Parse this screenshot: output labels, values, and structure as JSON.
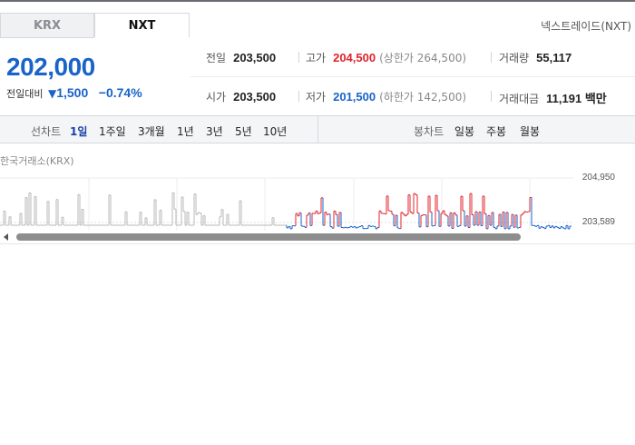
{
  "tabs": {
    "krx": "KRX",
    "nxt": "NXT",
    "exchange_name": "넥스트레이드(NXT)"
  },
  "price": {
    "current": "202,000",
    "diff_label": "전일대비",
    "diff_value": "1,500",
    "diff_rate": "−0.74%"
  },
  "stats": {
    "prev_close_label": "전일",
    "prev_close": "203,500",
    "high_label": "고가",
    "high": "204,500",
    "upper_limit": "(상한가 264,500)",
    "volume_label": "거래량",
    "volume": "55,117",
    "open_label": "시가",
    "open": "203,500",
    "low_label": "저가",
    "low": "201,500",
    "lower_limit": "(하한가 142,500)",
    "amount_label": "거래대금",
    "amount": "11,191 백만"
  },
  "period_bar": {
    "line_label": "선차트",
    "line_periods": [
      "1일",
      "1주일",
      "3개월",
      "1년",
      "3년",
      "5년",
      "10년"
    ],
    "candle_label": "봉차트",
    "candle_periods": [
      "일봉",
      "주봉",
      "월봉"
    ]
  },
  "chart": {
    "market_label": "한국거래소(KRX)",
    "y_top": "204,950",
    "y_mid": "203,589",
    "colors": {
      "up": "#e0242c",
      "down": "#1a63c9",
      "flat": "#b8b8b8"
    }
  }
}
